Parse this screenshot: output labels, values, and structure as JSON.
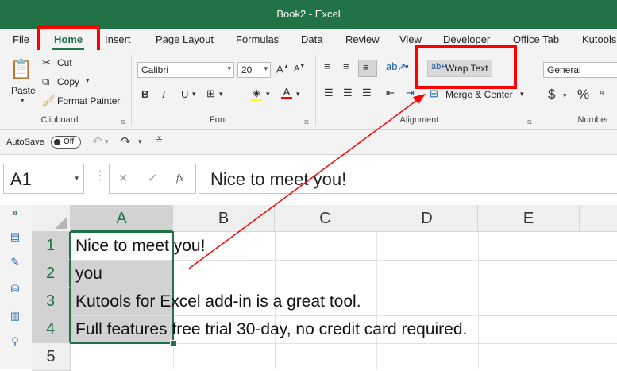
{
  "window": {
    "title": "Book2 - Excel"
  },
  "tabs": [
    "File",
    "Home",
    "Insert",
    "Page Layout",
    "Formulas",
    "Data",
    "Review",
    "View",
    "Developer",
    "Office Tab",
    "Kutools"
  ],
  "clipboard": {
    "paste": "Paste",
    "cut": "Cut",
    "copy": "Copy",
    "format_painter": "Format Painter",
    "label": "Clipboard"
  },
  "font": {
    "name": "Calibri",
    "size": "20",
    "bold": "B",
    "italic": "I",
    "underline": "U",
    "label": "Font"
  },
  "alignment": {
    "wrap_text": "Wrap Text",
    "merge_center": "Merge & Center",
    "label": "Alignment"
  },
  "number": {
    "format": "General",
    "currency": "$",
    "percent": "%",
    "label": "Number"
  },
  "qat": {
    "autosave": "AutoSave",
    "toggle": "Off"
  },
  "formula_bar": {
    "name_box": "A1",
    "cancel": "×",
    "enter": "✓",
    "fx": "fx",
    "content": "Nice to meet you!"
  },
  "columns": [
    "A",
    "B",
    "C",
    "D",
    "E"
  ],
  "rows": [
    {
      "num": "1",
      "text": "Nice to meet you!"
    },
    {
      "num": "2",
      "text": "you"
    },
    {
      "num": "3",
      "text": "Kutools for Excel add-in is a great tool."
    },
    {
      "num": "4",
      "text": "Full features free trial 30-day, no credit card required."
    },
    {
      "num": "5",
      "text": ""
    }
  ],
  "colors": {
    "accent": "#217346",
    "highlight_red": "#ff0000",
    "selection": "#d2d2d2"
  }
}
